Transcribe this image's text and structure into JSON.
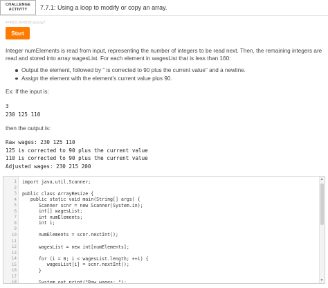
{
  "header": {
    "badge_line1": "CHALLENGE",
    "badge_line2": "ACTIVITY",
    "title": "7.7.1: Using a loop to modify or copy an array."
  },
  "activity_id": "474902.2478198.qx3zqy7",
  "start_button": "Start",
  "prompt": "Integer numElements is read from input, representing the number of integers to be read next. Then, the remaining integers are read and stored into array wagesList. For each element in wagesList that is less than 160:",
  "bullets": [
    "Output the element, followed by \" is corrected to 90 plus the current value\" and a newline.",
    "Assign the element with the element's current value plus 90."
  ],
  "example_input_label": "Ex: If the input is:",
  "example_input": [
    "3",
    "230 125 110"
  ],
  "then_label": "then the output is:",
  "example_output": [
    "Raw wages: 230 125 110",
    "125 is corrected to 90 plus the current value",
    "110 is corrected to 90 plus the current value",
    "Adjusted wages: 230 215 200"
  ],
  "code_lines": [
    {
      "n": "1",
      "text": "import java.util.Scanner;"
    },
    {
      "n": "2",
      "text": ""
    },
    {
      "n": "3",
      "text": "public class ArrayResize {"
    },
    {
      "n": "4",
      "text": "   public static void main(String[] args) {"
    },
    {
      "n": "5",
      "text": "      Scanner scnr = new Scanner(System.in);"
    },
    {
      "n": "6",
      "text": "      int[] wagesList;"
    },
    {
      "n": "7",
      "text": "      int numElements;"
    },
    {
      "n": "8",
      "text": "      int i;"
    },
    {
      "n": "9",
      "text": ""
    },
    {
      "n": "10",
      "text": "      numElements = scnr.nextInt();"
    },
    {
      "n": "11",
      "text": ""
    },
    {
      "n": "12",
      "text": "      wagesList = new int[numElements];"
    },
    {
      "n": "13",
      "text": ""
    },
    {
      "n": "14",
      "text": "      for (i = 0; i < wagesList.length; ++i) {"
    },
    {
      "n": "15",
      "text": "         wagesList[i] = scnr.nextInt();"
    },
    {
      "n": "16",
      "text": "      }"
    },
    {
      "n": "17",
      "text": ""
    },
    {
      "n": "18",
      "text": "      System.out.print(\"Raw wages: \");"
    }
  ],
  "colors": {
    "accent": "#ff7a00"
  }
}
